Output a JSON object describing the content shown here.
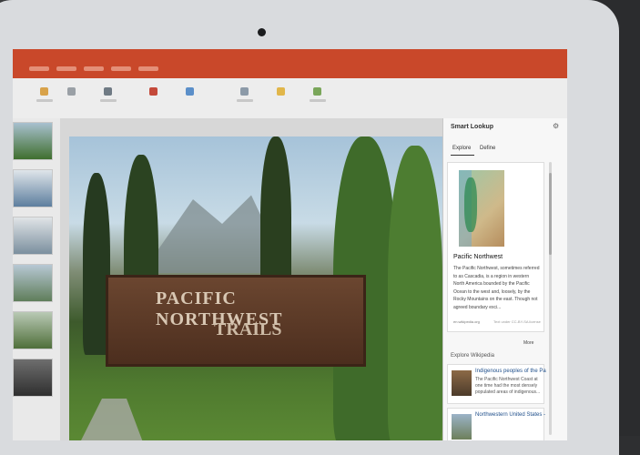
{
  "app": {
    "title": ""
  },
  "slide": {
    "sign_line1": "PACIFIC NORTHWEST",
    "sign_line2": "TRAILS"
  },
  "smart_lookup": {
    "title": "Smart Lookup",
    "close_icon": "gear-icon",
    "tabs": [
      "Explore",
      "Define"
    ],
    "card": {
      "heading": "Pacific Northwest",
      "body": "The Pacific Northwest, sometimes referred to as Cascadia, is a region in western North America bounded by the Pacific Ocean to the west and, loosely, by the Rocky Mountains on the east. Though not agreed boundary exci...",
      "source": "en.wikipedia.org",
      "license": "Text under CC-BY-SA license"
    },
    "more": "More",
    "explore_heading": "Explore Wikipedia",
    "results": [
      {
        "title": "Indigenous peoples of the Pa",
        "text": "The Pacific Northwest Coast at one time had the most densely populated areas of indigenous..."
      },
      {
        "title": "Northwestern United States -",
        "text": ""
      }
    ]
  },
  "colors": {
    "accent": "#c9482a"
  }
}
